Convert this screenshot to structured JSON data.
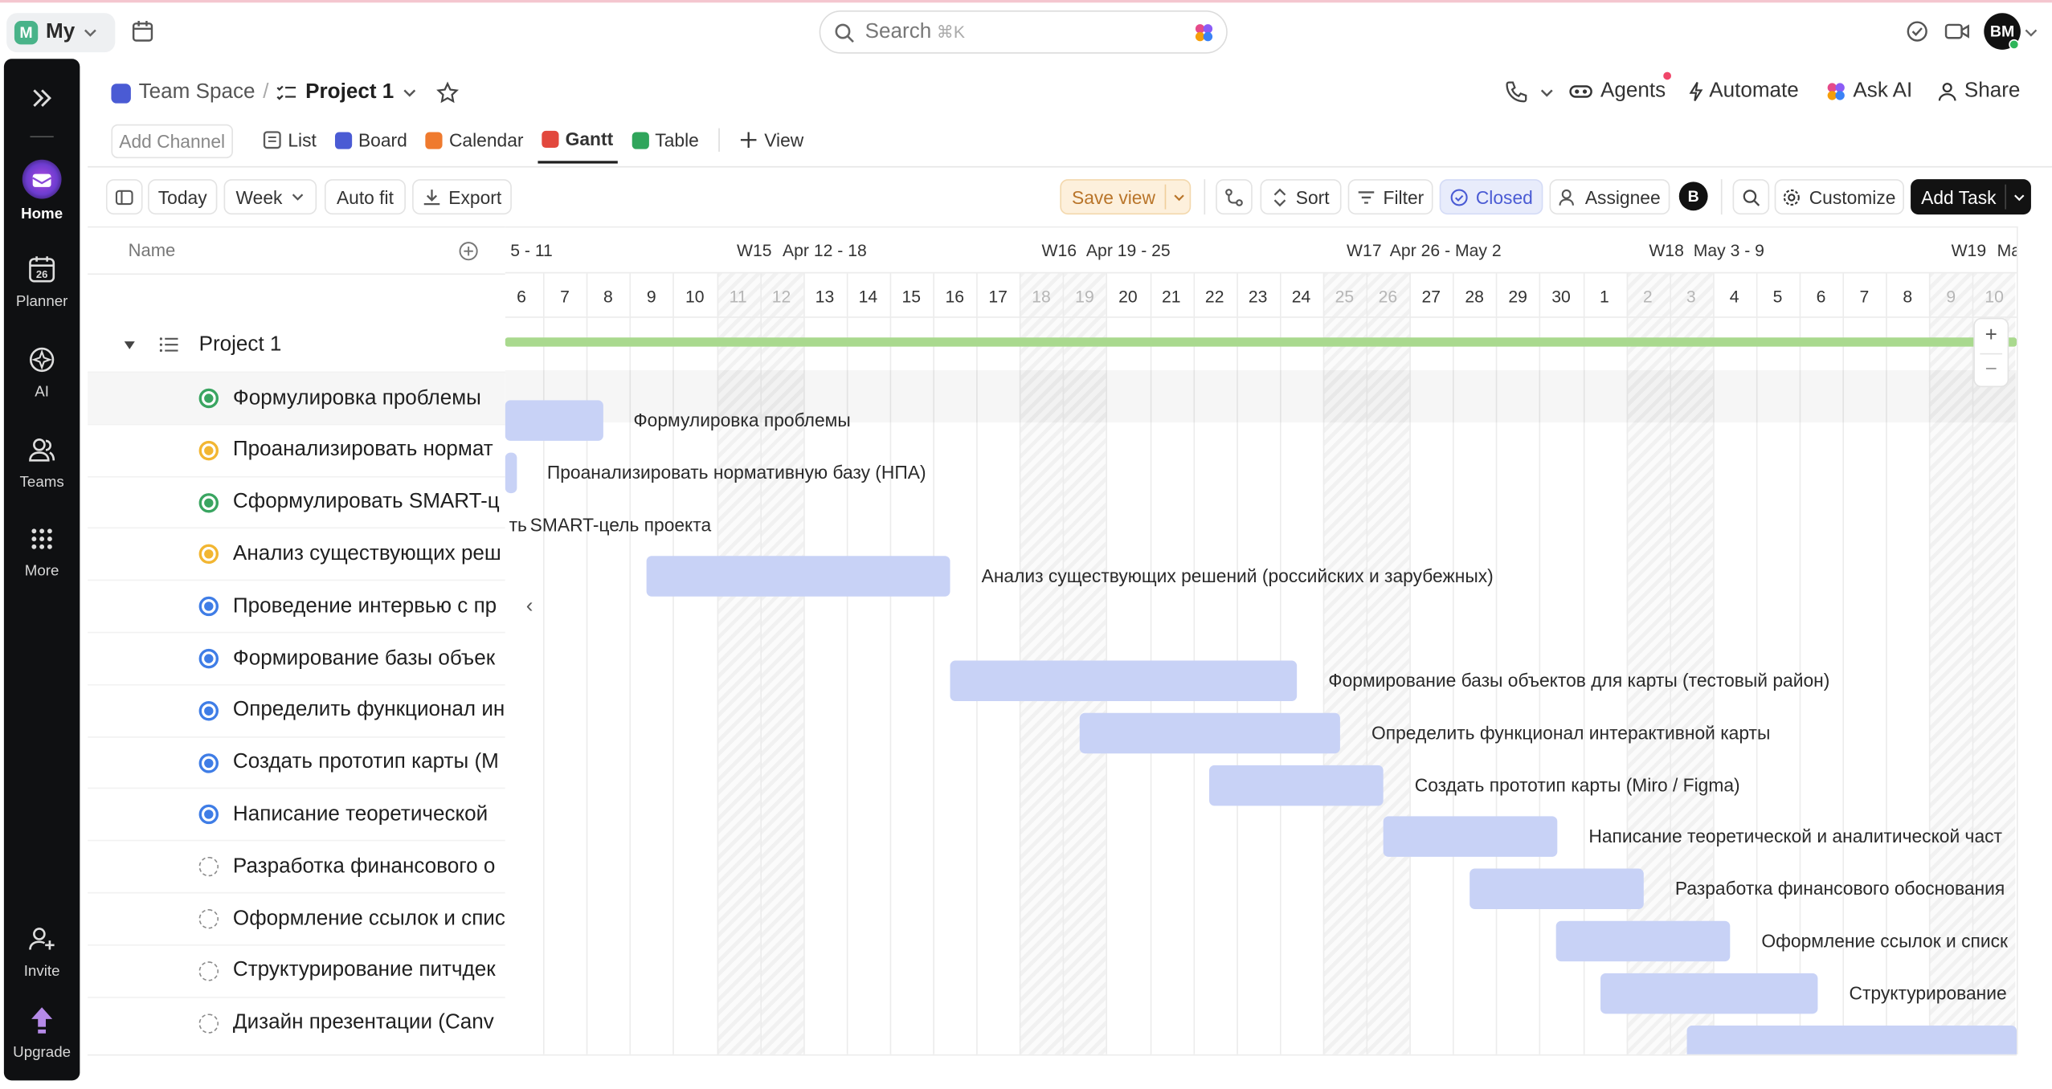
{
  "topbar": {
    "workspace_letter": "M",
    "workspace_label": "My",
    "search_placeholder": "Search",
    "search_shortcut": "⌘K",
    "avatar_initials": "BM"
  },
  "sidebar": {
    "items": [
      {
        "label": "Home",
        "icon": "home-icon"
      },
      {
        "label": "Planner",
        "icon": "calendar-icon"
      },
      {
        "label": "AI",
        "icon": "ai-icon"
      },
      {
        "label": "Teams",
        "icon": "teams-icon"
      },
      {
        "label": "More",
        "icon": "grid-icon"
      },
      {
        "label": "Invite",
        "icon": "invite-icon"
      },
      {
        "label": "Upgrade",
        "icon": "upgrade-icon"
      }
    ],
    "planner_day": "26"
  },
  "header": {
    "space": "Team Space",
    "separator": "/",
    "project": "Project 1",
    "actions": {
      "agents": "Agents",
      "automate": "Automate",
      "ask_ai": "Ask AI",
      "share": "Share"
    }
  },
  "tabs": {
    "add_channel": "Add Channel",
    "items": [
      {
        "label": "List",
        "color": "#5a5a5a"
      },
      {
        "label": "Board",
        "color": "#4a5bd4"
      },
      {
        "label": "Calendar",
        "color": "#ef7a2e"
      },
      {
        "label": "Gantt",
        "color": "#e2483d"
      },
      {
        "label": "Table",
        "color": "#2fa55b"
      }
    ],
    "active": "Gantt",
    "add_view": "View"
  },
  "toolbar": {
    "today": "Today",
    "week": "Week",
    "auto_fit": "Auto fit",
    "export": "Export",
    "save_view": "Save view",
    "sort": "Sort",
    "filter": "Filter",
    "closed": "Closed",
    "assignee": "Assignee",
    "assignee_initial": "B",
    "customize": "Customize",
    "add_task": "Add Task"
  },
  "list": {
    "name_header": "Name",
    "group": "Project 1",
    "tasks": [
      {
        "name": "Формулировка проблемы",
        "status": "done"
      },
      {
        "name": "Проанализировать нормат",
        "status": "in-progress"
      },
      {
        "name": "Сформулировать SMART-ц",
        "status": "done"
      },
      {
        "name": "Анализ существующих реш",
        "status": "in-progress"
      },
      {
        "name": "Проведение интервью с пр",
        "status": "todo-active"
      },
      {
        "name": "Формирование базы объек",
        "status": "todo-active"
      },
      {
        "name": "Определить функционал ин",
        "status": "todo-active"
      },
      {
        "name": "Создать прототип карты (M",
        "status": "todo-active"
      },
      {
        "name": "Написание теоретической",
        "status": "todo-active"
      },
      {
        "name": "Разработка финансового о",
        "status": "open"
      },
      {
        "name": "Оформление ссылок и спис",
        "status": "open"
      },
      {
        "name": "Структурирование питчдек",
        "status": "open"
      },
      {
        "name": "Дизайн презентации (Canv",
        "status": "open"
      }
    ]
  },
  "gantt": {
    "weeks": [
      {
        "label": "5 - 11",
        "num": "W15"
      },
      {
        "label": "Apr 12 - 18",
        "num": "W16"
      },
      {
        "label": "Apr 19 - 25",
        "num": "W17"
      },
      {
        "label": "Apr 26 - May 2",
        "num": "W18"
      },
      {
        "label": "May 3 - 9",
        "num": "W19"
      },
      {
        "label": "Ma",
        "num": ""
      }
    ],
    "days": [
      "6",
      "7",
      "8",
      "9",
      "10",
      "11",
      "12",
      "13",
      "14",
      "15",
      "16",
      "17",
      "18",
      "19",
      "20",
      "21",
      "22",
      "23",
      "24",
      "25",
      "26",
      "27",
      "28",
      "29",
      "30",
      "1",
      "2",
      "3",
      "4",
      "5",
      "6",
      "7",
      "8",
      "9",
      "10"
    ],
    "weekend_days": [
      5,
      6,
      12,
      13,
      19,
      20,
      26,
      27,
      33,
      34
    ],
    "bar_labels": [
      "Формулировка проблемы",
      "Проанализировать нормативную базу (НПА)",
      "SMART-цель проекта",
      "Анализ существующих решений (российских и зарубежных)",
      "Формирование базы объектов для карты (тестовый район)",
      "Определить функционал интерактивной карты",
      "Создать прототип карты (Miro / Figma)",
      "Написание теоретической и аналитической част",
      "Разработка финансового обоснования",
      "Оформление ссылок и списк",
      "Структурирование"
    ],
    "smart_prefix": "ть ",
    "zoom_in": "+",
    "zoom_out": "−",
    "collapse": "‹"
  }
}
